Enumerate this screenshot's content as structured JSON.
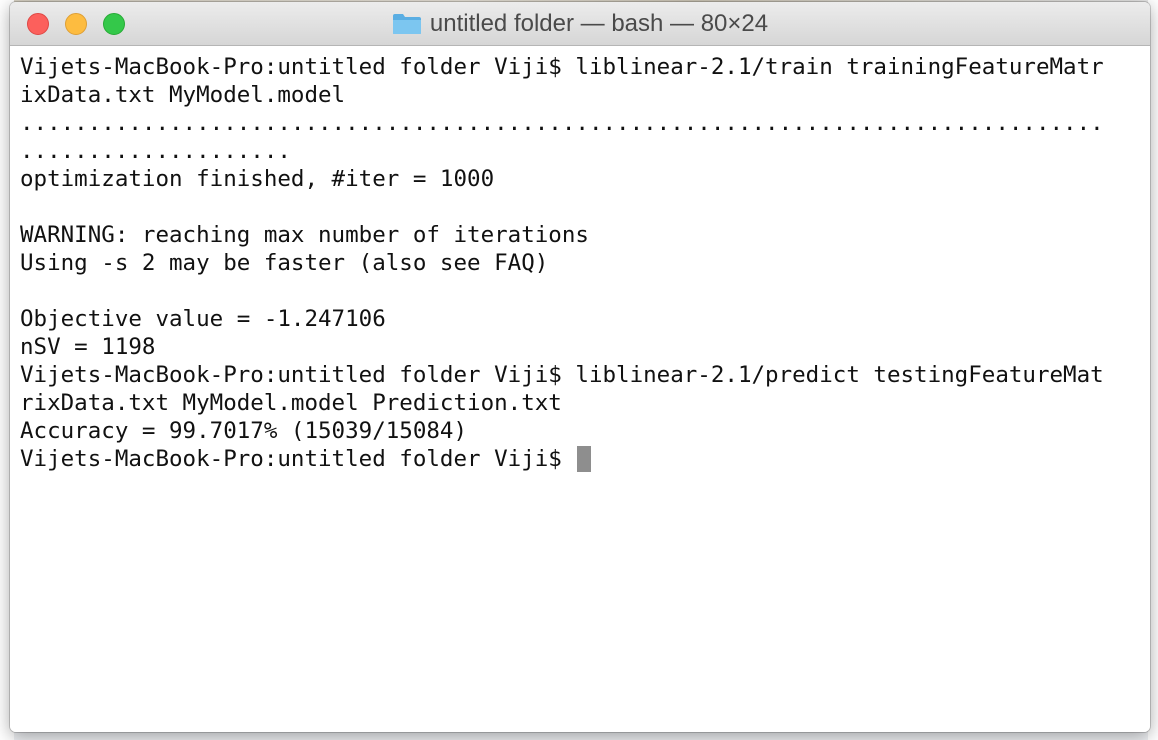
{
  "window": {
    "title": "untitled folder — bash — 80×24",
    "folder_icon": "folder-icon",
    "buttons": {
      "close": "close",
      "minimize": "minimize",
      "zoom": "zoom"
    }
  },
  "terminal": {
    "lines": [
      "Vijets-MacBook-Pro:untitled folder Viji$ liblinear-2.1/train trainingFeatureMatr",
      "ixData.txt MyModel.model",
      "................................................................................",
      "....................",
      "optimization finished, #iter = 1000",
      "",
      "WARNING: reaching max number of iterations",
      "Using -s 2 may be faster (also see FAQ)",
      "",
      "Objective value = -1.247106",
      "nSV = 1198",
      "Vijets-MacBook-Pro:untitled folder Viji$ liblinear-2.1/predict testingFeatureMat",
      "rixData.txt MyModel.model Prediction.txt",
      "Accuracy = 99.7017% (15039/15084)"
    ],
    "prompt": "Vijets-MacBook-Pro:untitled folder Viji$ "
  },
  "colors": {
    "close": "#fc605c",
    "minimize": "#fdbc40",
    "zoom": "#34c84a",
    "text": "#111111",
    "cursor": "#8e8e8e",
    "folder": "#6cb8e8"
  }
}
